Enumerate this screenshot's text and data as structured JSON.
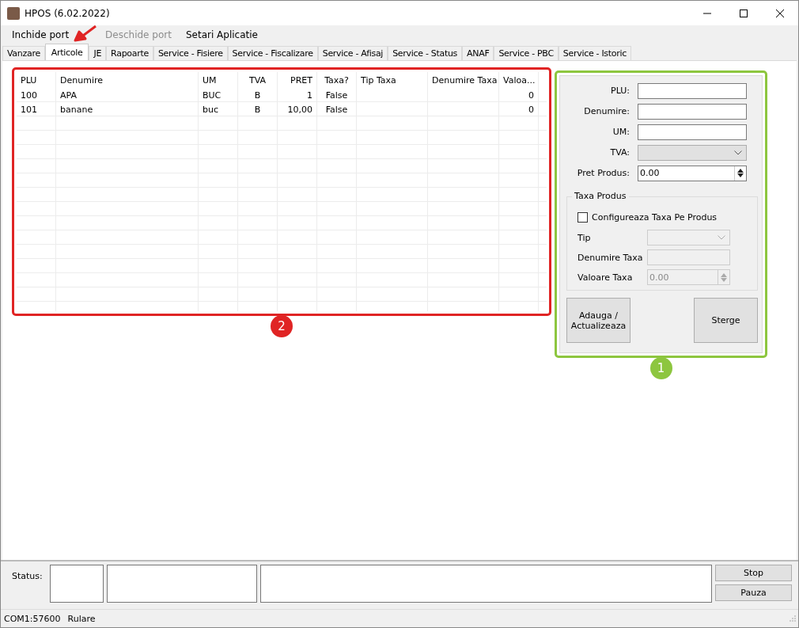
{
  "window": {
    "title": "HPOS (6.02.2022)"
  },
  "menu": [
    {
      "label": "Inchide port",
      "disabled": false
    },
    {
      "label": "Deschide port",
      "disabled": true
    },
    {
      "label": "Setari Aplicatie",
      "disabled": false
    }
  ],
  "tabs": [
    {
      "label": "Vanzare",
      "selected": false
    },
    {
      "label": "Articole",
      "selected": true
    },
    {
      "label": "JE",
      "selected": false
    },
    {
      "label": "Rapoarte",
      "selected": false
    },
    {
      "label": "Service - Fisiere",
      "selected": false
    },
    {
      "label": "Service - Fiscalizare",
      "selected": false
    },
    {
      "label": "Service - Afisaj",
      "selected": false
    },
    {
      "label": "Service - Status",
      "selected": false
    },
    {
      "label": "ANAF",
      "selected": false
    },
    {
      "label": "Service - PBC",
      "selected": false
    },
    {
      "label": "Service - Istoric",
      "selected": false
    }
  ],
  "table": {
    "columns": [
      "PLU",
      "Denumire",
      "UM",
      "TVA",
      "PRET",
      "Taxa?",
      "Tip Taxa",
      "Denumire Taxa",
      "Valoa..."
    ],
    "rows": [
      [
        "100",
        "APA",
        "BUC",
        "B",
        "1",
        "False",
        null,
        null,
        "0"
      ],
      [
        "101",
        "banane",
        "buc",
        "B",
        "10,00",
        "False",
        null,
        null,
        "0"
      ]
    ]
  },
  "form": {
    "fields": [
      {
        "label": "PLU:",
        "kind": "text",
        "disabled": false
      },
      {
        "label": "Denumire:",
        "kind": "text",
        "disabled": false
      },
      {
        "label": "UM:",
        "kind": "text",
        "disabled": false
      },
      {
        "label": "TVA:",
        "kind": "combo",
        "disabled": false
      },
      {
        "label": "Pret Produs:",
        "kind": "spin",
        "value": "0.00",
        "disabled": false
      }
    ],
    "tax_group": {
      "title": "Taxa Produs",
      "checkbox": {
        "label": "Configureaza Taxa Pe Produs",
        "checked": false
      },
      "fields": [
        {
          "label": "Tip",
          "kind": "combo",
          "disabled": true
        },
        {
          "label": "Denumire Taxa",
          "kind": "text",
          "disabled": true
        },
        {
          "label": "Valoare Taxa",
          "kind": "spin",
          "value": "0.00",
          "disabled": true
        }
      ]
    },
    "buttons": [
      "Adauga / Actualizeaza",
      "Sterge"
    ]
  },
  "status": {
    "label": "Status:",
    "buttons": [
      "Stop",
      "Pauza"
    ]
  },
  "status_bar": [
    "COM1:57600",
    "Rulare"
  ],
  "annotations": [
    {
      "label": "1",
      "color": "#8dc63f"
    },
    {
      "label": "2",
      "color": "#e02424"
    }
  ]
}
